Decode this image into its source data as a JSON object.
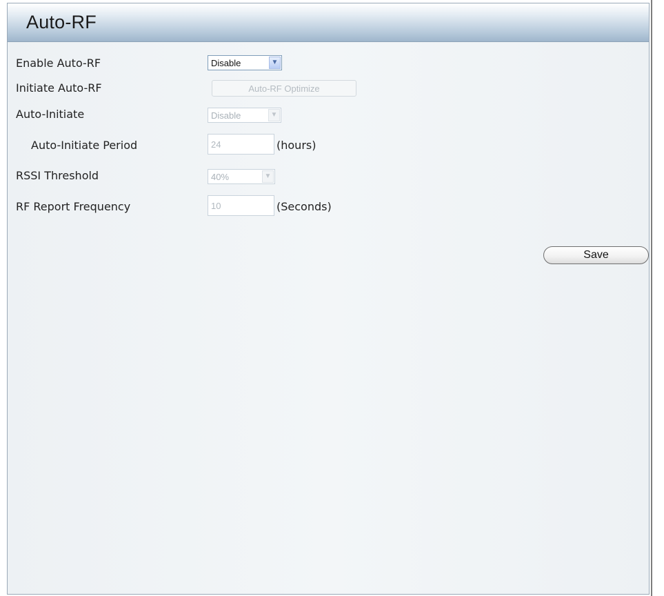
{
  "panel": {
    "title": "Auto-RF"
  },
  "form": {
    "enable_auto_rf": {
      "label": "Enable Auto-RF",
      "value": "Disable"
    },
    "initiate_auto_rf": {
      "label": "Initiate Auto-RF",
      "button_label": "Auto-RF Optimize"
    },
    "auto_initiate": {
      "label": "Auto-Initiate",
      "value": "Disable"
    },
    "auto_initiate_period": {
      "label": "Auto-Initiate Period",
      "value": "24",
      "unit": "(hours)"
    },
    "rssi_threshold": {
      "label": "RSSI Threshold",
      "value": "40%"
    },
    "rf_report_frequency": {
      "label": "RF Report Frequency",
      "value": "10",
      "unit": "(Seconds)"
    }
  },
  "actions": {
    "save_label": "Save"
  },
  "icons": {
    "dropdown": "chevron-down-icon"
  }
}
